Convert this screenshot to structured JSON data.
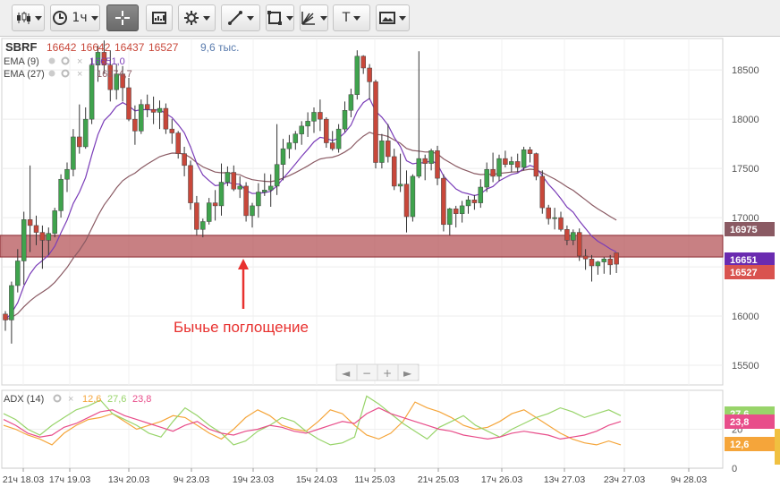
{
  "toolbar": {
    "buttons": [
      {
        "name": "chart-type-button",
        "icon": "candlestick-icon",
        "caret": true
      },
      {
        "name": "timeframe-button",
        "icon": "clock-icon",
        "label": "1ч",
        "caret": true
      },
      {
        "name": "crosshair-button",
        "icon": "crosshair-icon",
        "caret": false,
        "active": true
      },
      {
        "name": "indicators-button",
        "icon": "indicators-icon",
        "caret": false
      },
      {
        "name": "settings-button",
        "icon": "gear-icon",
        "caret": true
      },
      {
        "name": "line-tool-button",
        "icon": "trendline-icon",
        "caret": true
      },
      {
        "name": "shapes-button",
        "icon": "rectangle-icon",
        "caret": true
      },
      {
        "name": "analysis-tools-button",
        "icon": "fibonacci-icon",
        "caret": true
      },
      {
        "name": "text-tool-button",
        "icon": "text-icon",
        "label": "T",
        "caret": true
      },
      {
        "name": "screenshot-button",
        "icon": "image-icon",
        "caret": true
      }
    ]
  },
  "legend": {
    "symbol": "SBRF",
    "open": "16642",
    "high": "16642",
    "low": "16437",
    "close": "16527",
    "volume": "9,6 тыс.",
    "ema9_label": "EMA (9)",
    "ema9_value": "16651,0",
    "ema27_label": "EMA (27)",
    "ema27_value": "16974,7",
    "adx_label": "ADX (14)",
    "adx_values": [
      "12,6",
      "27,6",
      "23,8"
    ]
  },
  "annotation": {
    "text": "Бычье поглощение",
    "color": "#e8312f"
  },
  "navigator": {
    "buttons": [
      "◄",
      "−",
      "+",
      "►"
    ]
  },
  "colors": {
    "up": "#3fa34d",
    "down": "#c8473a",
    "ema9": "#7a3cb8",
    "ema27": "#8a5a63",
    "support_zone": "#b5555a",
    "adx_plus_di": "#98d46a",
    "adx_minus_di": "#e84d8a",
    "adx_line": "#f5a53a"
  },
  "chart_data": [
    {
      "type": "candlestick",
      "title": "SBRF",
      "interval": "1ч",
      "x_ticks": [
        "21ч 18.03",
        "17ч 19.03",
        "13ч 20.03",
        "9ч 23.03",
        "19ч 23.03",
        "15ч 24.03",
        "11ч 25.03",
        "21ч 25.03",
        "17ч 26.03",
        "13ч 27.03",
        "23ч 27.03",
        "9ч 28.03"
      ],
      "y_ticks": [
        15500,
        16000,
        16500,
        17000,
        17500,
        18000,
        18500
      ],
      "ylim": [
        15300,
        18820
      ],
      "candles": [
        [
          16020,
          16050,
          15850,
          15960
        ],
        [
          15960,
          16350,
          15720,
          16310
        ],
        [
          16310,
          16680,
          16240,
          16560
        ],
        [
          16560,
          17060,
          16320,
          16980
        ],
        [
          16980,
          17530,
          16650,
          16920
        ],
        [
          16920,
          17020,
          16720,
          16850
        ],
        [
          16850,
          16920,
          16480,
          16770
        ],
        [
          16770,
          16900,
          16620,
          16840
        ],
        [
          16840,
          17100,
          16800,
          17070
        ],
        [
          17070,
          17440,
          17000,
          17390
        ],
        [
          17390,
          17560,
          17260,
          17490
        ],
        [
          17490,
          17900,
          17420,
          17820
        ],
        [
          17820,
          18150,
          17650,
          17720
        ],
        [
          17720,
          18120,
          17700,
          18000
        ],
        [
          18000,
          18620,
          17950,
          18550
        ],
        [
          18550,
          18750,
          18380,
          18680
        ],
        [
          18680,
          18800,
          18460,
          18550
        ],
        [
          18550,
          18700,
          18180,
          18300
        ],
        [
          18300,
          18560,
          18200,
          18460
        ],
        [
          18460,
          18540,
          18180,
          18320
        ],
        [
          18320,
          18420,
          17980,
          18000
        ],
        [
          18000,
          18140,
          17740,
          17880
        ],
        [
          17880,
          18200,
          17850,
          18150
        ],
        [
          18150,
          18250,
          18020,
          18100
        ],
        [
          18100,
          18230,
          17950,
          18070
        ],
        [
          18070,
          18190,
          17900,
          18110
        ],
        [
          18110,
          18160,
          17850,
          17900
        ],
        [
          17900,
          18000,
          17750,
          17860
        ],
        [
          17860,
          17880,
          17600,
          17650
        ],
        [
          17650,
          17720,
          17420,
          17530
        ],
        [
          17530,
          17580,
          17080,
          17150
        ],
        [
          17150,
          17220,
          16820,
          16880
        ],
        [
          16880,
          16990,
          16800,
          16960
        ],
        [
          16960,
          17200,
          16930,
          17150
        ],
        [
          17150,
          17280,
          16970,
          17120
        ],
        [
          17120,
          17550,
          17020,
          17360
        ],
        [
          17360,
          17520,
          17320,
          17460
        ],
        [
          17460,
          17530,
          17270,
          17290
        ],
        [
          17290,
          17420,
          17200,
          17320
        ],
        [
          17320,
          17360,
          16960,
          17020
        ],
        [
          17020,
          17150,
          16900,
          17120
        ],
        [
          17120,
          17350,
          17000,
          17260
        ],
        [
          17260,
          17450,
          17220,
          17280
        ],
        [
          17280,
          17440,
          17110,
          17320
        ],
        [
          17320,
          17950,
          17230,
          17540
        ],
        [
          17540,
          17800,
          17380,
          17700
        ],
        [
          17700,
          17840,
          17600,
          17760
        ],
        [
          17760,
          17880,
          17690,
          17850
        ],
        [
          17850,
          17980,
          17740,
          17930
        ],
        [
          17930,
          18070,
          17820,
          17980
        ],
        [
          17980,
          18120,
          17860,
          18070
        ],
        [
          18070,
          18200,
          17880,
          18000
        ],
        [
          18000,
          18020,
          17710,
          17760
        ],
        [
          17760,
          17880,
          17680,
          17700
        ],
        [
          17700,
          17950,
          17660,
          17900
        ],
        [
          17900,
          18180,
          17870,
          18090
        ],
        [
          18090,
          18310,
          18020,
          18250
        ],
        [
          18250,
          18700,
          18200,
          18640
        ],
        [
          18640,
          18650,
          18460,
          18520
        ],
        [
          18520,
          18560,
          18200,
          18380
        ],
        [
          18380,
          18400,
          17500,
          17560
        ],
        [
          17560,
          17850,
          17500,
          17780
        ],
        [
          17780,
          17950,
          17560,
          17620
        ],
        [
          17620,
          17700,
          17280,
          17320
        ],
        [
          17320,
          17650,
          17260,
          17340
        ],
        [
          17340,
          17480,
          16850,
          17010
        ],
        [
          17010,
          17440,
          16960,
          17420
        ],
        [
          17420,
          18690,
          17400,
          17600
        ],
        [
          17600,
          17640,
          17380,
          17550
        ],
        [
          17550,
          17700,
          17480,
          17680
        ],
        [
          17680,
          17730,
          17330,
          17400
        ],
        [
          17400,
          17440,
          16860,
          16930
        ],
        [
          16930,
          17100,
          16820,
          17090
        ],
        [
          17090,
          17120,
          16900,
          17040
        ],
        [
          17040,
          17170,
          16950,
          17120
        ],
        [
          17120,
          17220,
          17040,
          17180
        ],
        [
          17180,
          17230,
          17080,
          17150
        ],
        [
          17150,
          17390,
          17100,
          17310
        ],
        [
          17310,
          17560,
          17260,
          17490
        ],
        [
          17490,
          17660,
          17360,
          17420
        ],
        [
          17420,
          17640,
          17370,
          17600
        ],
        [
          17600,
          17680,
          17510,
          17540
        ],
        [
          17540,
          17620,
          17460,
          17570
        ],
        [
          17570,
          17650,
          17460,
          17510
        ],
        [
          17510,
          17720,
          17480,
          17690
        ],
        [
          17690,
          17720,
          17560,
          17650
        ],
        [
          17650,
          17660,
          17380,
          17420
        ],
        [
          17420,
          17480,
          17040,
          17100
        ],
        [
          17100,
          17130,
          16930,
          16990
        ],
        [
          16990,
          17100,
          16880,
          17000
        ],
        [
          17000,
          17060,
          16860,
          16880
        ],
        [
          16880,
          16920,
          16720,
          16770
        ],
        [
          16770,
          16880,
          16720,
          16850
        ],
        [
          16850,
          16890,
          16560,
          16610
        ],
        [
          16610,
          16680,
          16470,
          16580
        ],
        [
          16580,
          16620,
          16350,
          16510
        ],
        [
          16510,
          16560,
          16420,
          16550
        ],
        [
          16550,
          16600,
          16430,
          16580
        ],
        [
          16580,
          16620,
          16420,
          16520
        ],
        [
          16642,
          16642,
          16437,
          16527
        ]
      ],
      "series": [
        {
          "name": "EMA (9)",
          "last": 16651.0
        },
        {
          "name": "EMA (27)",
          "last": 16974.7
        }
      ],
      "support_zone": [
        16600,
        16820
      ],
      "price_labels": [
        16975,
        16651,
        16527
      ]
    },
    {
      "type": "line",
      "title": "ADX (14)",
      "y_ticks": [
        0,
        20
      ],
      "ylim": [
        0,
        40
      ],
      "x_ticks": [
        "21ч 18.03",
        "17ч 19.03",
        "13ч 20.03",
        "9ч 23.03",
        "19ч 23.03",
        "15ч 24.03",
        "11ч 25.03",
        "21ч 25.03",
        "17ч 26.03",
        "13ч 27.03",
        "23ч 27.03",
        "9ч 28.03"
      ],
      "series": [
        {
          "name": "ADX",
          "values": [
            22,
            20,
            17,
            15,
            12,
            18,
            22,
            25,
            26,
            28,
            24,
            20,
            22,
            24,
            27,
            26,
            22,
            18,
            15,
            20,
            26,
            30,
            27,
            22,
            20,
            19,
            24,
            30,
            28,
            22,
            17,
            15,
            18,
            24,
            34,
            31,
            29,
            26,
            22,
            20,
            21,
            24,
            28,
            30,
            26,
            22,
            18,
            15,
            13,
            12,
            14,
            12
          ]
        },
        {
          "name": "+DI",
          "values": [
            28,
            25,
            20,
            17,
            22,
            26,
            30,
            32,
            35,
            28,
            25,
            22,
            18,
            16,
            24,
            31,
            27,
            22,
            18,
            12,
            14,
            19,
            22,
            26,
            24,
            19,
            15,
            12,
            13,
            16,
            37,
            33,
            28,
            23,
            19,
            15,
            21,
            24,
            27,
            22,
            19,
            16,
            20,
            23,
            26,
            28,
            31,
            29,
            26,
            28,
            30,
            27
          ]
        },
        {
          "name": "−DI",
          "values": [
            25,
            22,
            18,
            16,
            17,
            21,
            23,
            26,
            29,
            30,
            27,
            25,
            23,
            21,
            19,
            22,
            24,
            20,
            18,
            17,
            19,
            20,
            22,
            21,
            19,
            18,
            20,
            22,
            24,
            23,
            28,
            31,
            28,
            26,
            24,
            22,
            20,
            19,
            17,
            16,
            15,
            16,
            18,
            19,
            18,
            17,
            15,
            16,
            17,
            19,
            22,
            24
          ]
        }
      ],
      "legend": [
        "12,6",
        "27,6",
        "23,8"
      ]
    }
  ]
}
